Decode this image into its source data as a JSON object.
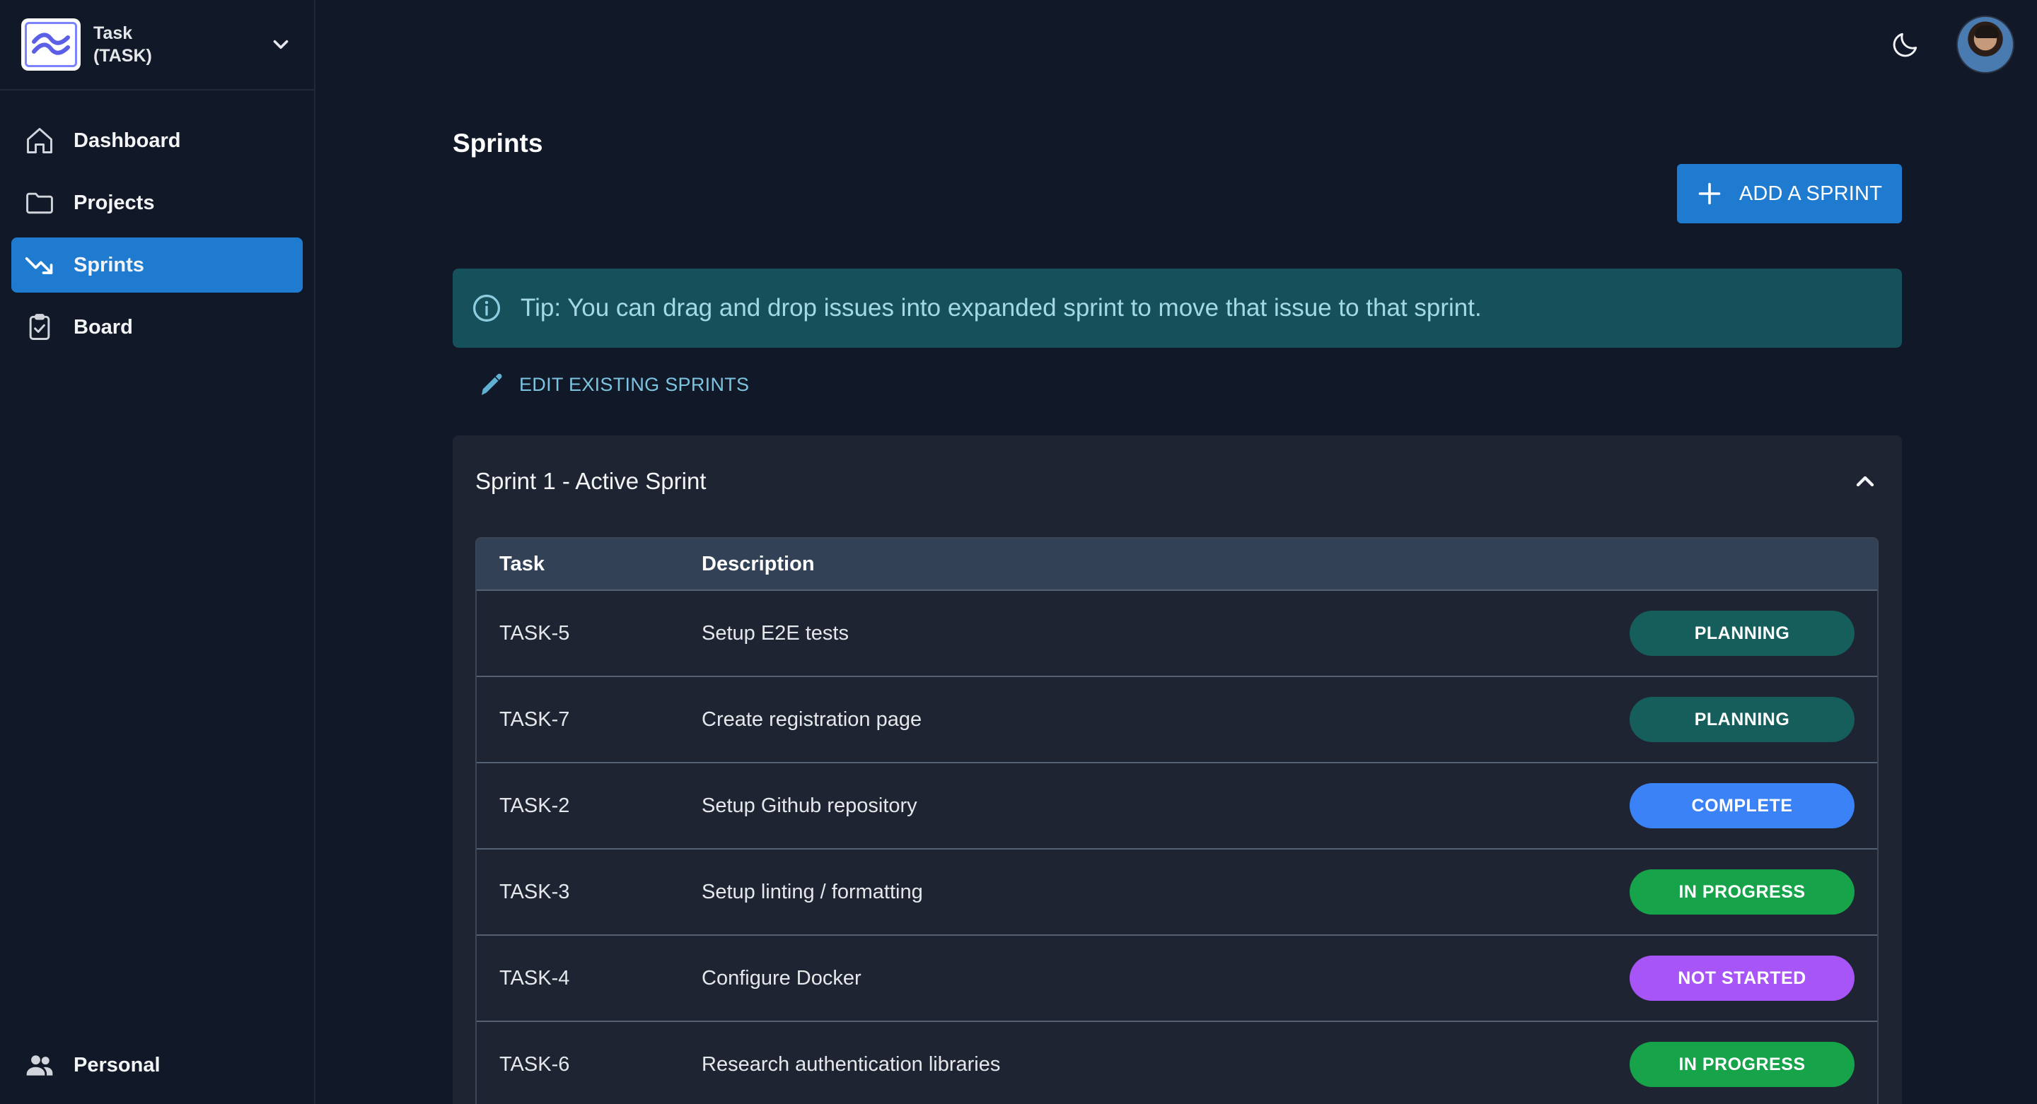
{
  "project": {
    "name": "Task",
    "key": "(TASK)"
  },
  "sidebar": {
    "items": [
      {
        "label": "Dashboard",
        "icon": "home-icon"
      },
      {
        "label": "Projects",
        "icon": "folder-icon"
      },
      {
        "label": "Sprints",
        "icon": "trending-down-icon",
        "active": true
      },
      {
        "label": "Board",
        "icon": "clipboard-check-icon"
      }
    ],
    "bottom": {
      "label": "Personal",
      "icon": "people-icon"
    }
  },
  "header": {
    "theme_icon": "moon-icon",
    "avatar": "user-avatar"
  },
  "main": {
    "title": "Sprints",
    "add_button": "ADD A SPRINT",
    "tip": "Tip: You can drag and drop issues into expanded sprint to move that issue to that sprint.",
    "edit_link": "EDIT EXISTING SPRINTS"
  },
  "sprint": {
    "title": "Sprint 1 - Active Sprint",
    "columns": [
      "Task",
      "Description"
    ],
    "rows": [
      {
        "task": "TASK-5",
        "description": "Setup E2E tests",
        "status": "PLANNING"
      },
      {
        "task": "TASK-7",
        "description": "Create registration page",
        "status": "PLANNING"
      },
      {
        "task": "TASK-2",
        "description": "Setup Github repository",
        "status": "COMPLETE"
      },
      {
        "task": "TASK-3",
        "description": "Setup linting / formatting",
        "status": "IN PROGRESS"
      },
      {
        "task": "TASK-4",
        "description": "Configure Docker",
        "status": "NOT STARTED"
      },
      {
        "task": "TASK-6",
        "description": "Research authentication libraries",
        "status": "IN PROGRESS"
      }
    ]
  },
  "colors": {
    "accent": "#1f7bd0",
    "planning": "#155e5b",
    "complete": "#3b82f6",
    "in_progress": "#16a34a",
    "not_started": "#a855f7",
    "tip_bg": "#16505b"
  }
}
